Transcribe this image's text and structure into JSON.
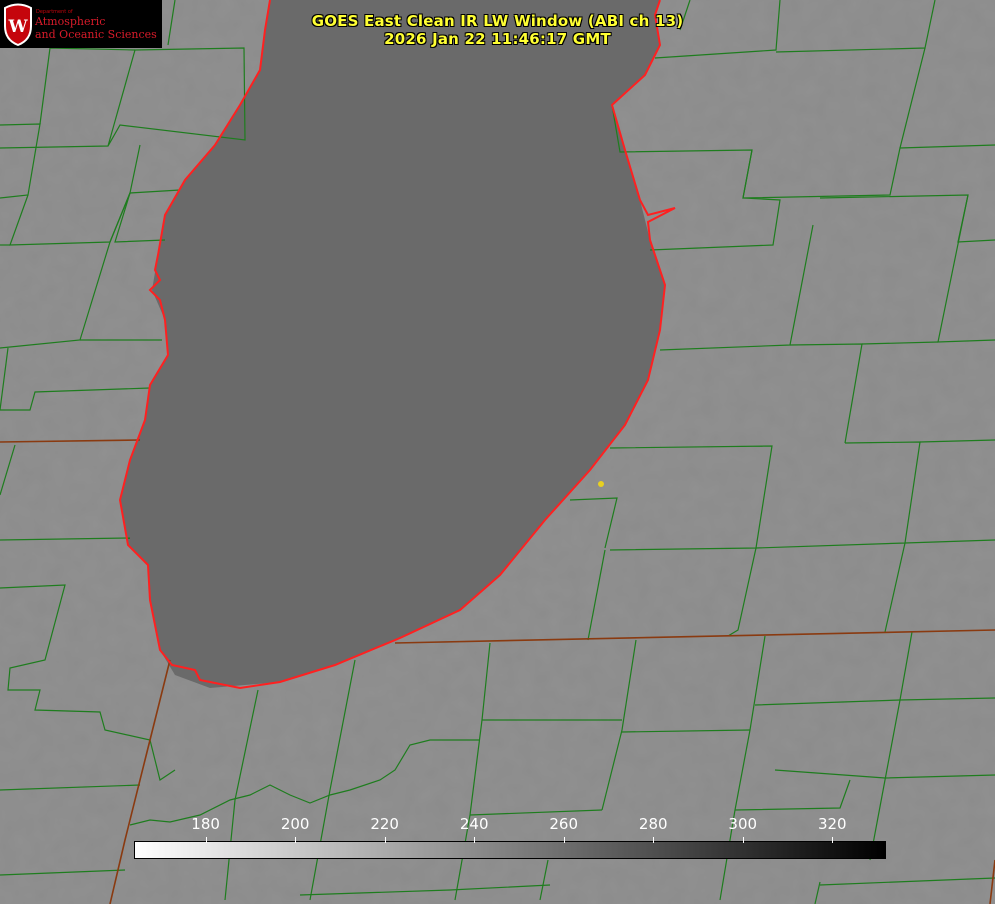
{
  "header": {
    "title_line1": "GOES East Clean IR LW Window (ABI ch 13)",
    "title_line2": "2026 Jan 22 11:46:17 GMT"
  },
  "logo": {
    "dept": "Department of",
    "line1": "Atmospheric",
    "line2": "and Oceanic Sciences",
    "crest_letter": "W",
    "color": "#c5050c"
  },
  "colorbar": {
    "ticks": [
      "180",
      "200",
      "220",
      "240",
      "260",
      "280",
      "300",
      "320"
    ],
    "min": 164,
    "max": 332,
    "scale": "linear",
    "color_min": "#ffffff",
    "color_max": "#000000"
  },
  "map": {
    "land_color": "#8b8b8b",
    "lake_color": "#6a6a6a",
    "county_line_color": "#1e7d1e",
    "state_line_color": "#8a3a10",
    "coastline_color": "#ff2020",
    "marker_color": "#e8d020"
  }
}
